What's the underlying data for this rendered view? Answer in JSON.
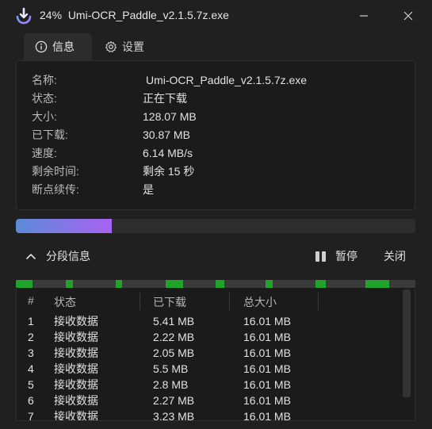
{
  "window": {
    "progress_percent": "24%",
    "filename": "Umi-OCR_Paddle_v2.1.5.7z.exe",
    "app_icon": "download-arrow-icon",
    "minimize_icon": "minimize-icon",
    "close_icon": "close-icon"
  },
  "tabs": [
    {
      "label": "信息",
      "icon": "info-icon",
      "active": true
    },
    {
      "label": "设置",
      "icon": "gear-icon",
      "active": false
    }
  ],
  "info": [
    {
      "label": "名称:",
      "value": "Umi-OCR_Paddle_v2.1.5.7z.exe"
    },
    {
      "label": "状态:",
      "value": "正在下载"
    },
    {
      "label": "大小:",
      "value": "128.07 MB"
    },
    {
      "label": "已下载:",
      "value": "30.87 MB"
    },
    {
      "label": "速度:",
      "value": "6.14 MB/s"
    },
    {
      "label": "剩余时间:",
      "value": "剩余 15 秒"
    },
    {
      "label": "断点续传:",
      "value": "是"
    }
  ],
  "progress": {
    "fraction": 0.24,
    "start_color": "#5b8bd6",
    "end_color": "#a962f2"
  },
  "segments": {
    "toggle_label": "分段信息",
    "toggle_icon": "chevron-up-icon",
    "pause_label": "暂停",
    "pause_icon": "pause-icon",
    "close_label": "关闭",
    "done_color": "#1fa32a",
    "map": [
      {
        "start": 0.0,
        "done": 0.042
      },
      {
        "start": 0.125,
        "done": 0.0175
      },
      {
        "start": 0.25,
        "done": 0.016
      },
      {
        "start": 0.375,
        "done": 0.043
      },
      {
        "start": 0.5,
        "done": 0.022
      },
      {
        "start": 0.625,
        "done": 0.0177
      },
      {
        "start": 0.75,
        "done": 0.025
      },
      {
        "start": 0.875,
        "done": 0.06
      }
    ]
  },
  "table": {
    "headers": [
      "#",
      "状态",
      "已下载",
      "总大小"
    ],
    "rows": [
      [
        "1",
        "接收数据",
        "5.41 MB",
        "16.01 MB"
      ],
      [
        "2",
        "接收数据",
        "2.22 MB",
        "16.01 MB"
      ],
      [
        "3",
        "接收数据",
        "2.05 MB",
        "16.01 MB"
      ],
      [
        "4",
        "接收数据",
        "5.5 MB",
        "16.01 MB"
      ],
      [
        "5",
        "接收数据",
        "2.8 MB",
        "16.01 MB"
      ],
      [
        "6",
        "接收数据",
        "2.27 MB",
        "16.01 MB"
      ],
      [
        "7",
        "接收数据",
        "3.23 MB",
        "16.01 MB"
      ]
    ]
  }
}
